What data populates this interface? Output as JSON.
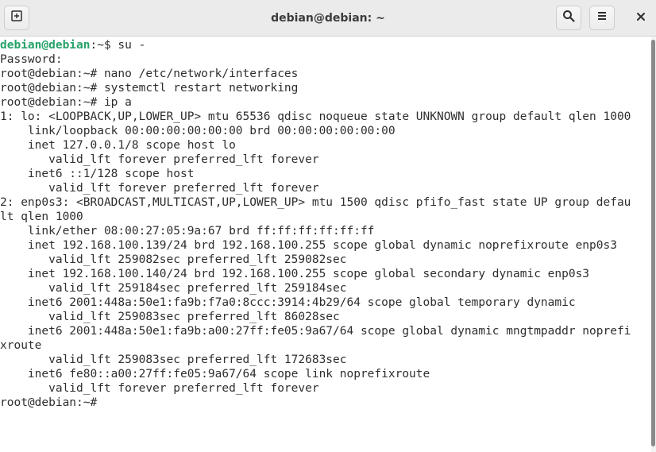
{
  "window": {
    "title": "debian@debian: ~"
  },
  "icons": {
    "new_tab": "new-tab-icon",
    "search": "search-icon",
    "menu": "hamburger-menu-icon",
    "close": "close-icon"
  },
  "colors": {
    "prompt_user": "#26a269",
    "text": "#2e2e2e",
    "titlebar": "#ebebeb"
  },
  "terminal": {
    "first_prompt": {
      "user": "debian@debian",
      "rest": ":~$ su -"
    },
    "lines": [
      "Password:",
      "root@debian:~# nano /etc/network/interfaces",
      "root@debian:~# systemctl restart networking",
      "root@debian:~# ip a",
      "1: lo: <LOOPBACK,UP,LOWER_UP> mtu 65536 qdisc noqueue state UNKNOWN group default qlen 1000",
      "    link/loopback 00:00:00:00:00:00 brd 00:00:00:00:00:00",
      "    inet 127.0.0.1/8 scope host lo",
      "       valid_lft forever preferred_lft forever",
      "    inet6 ::1/128 scope host",
      "       valid_lft forever preferred_lft forever",
      "2: enp0s3: <BROADCAST,MULTICAST,UP,LOWER_UP> mtu 1500 qdisc pfifo_fast state UP group defau",
      "lt qlen 1000",
      "    link/ether 08:00:27:05:9a:67 brd ff:ff:ff:ff:ff:ff",
      "    inet 192.168.100.139/24 brd 192.168.100.255 scope global dynamic noprefixroute enp0s3",
      "       valid_lft 259082sec preferred_lft 259082sec",
      "    inet 192.168.100.140/24 brd 192.168.100.255 scope global secondary dynamic enp0s3",
      "       valid_lft 259184sec preferred_lft 259184sec",
      "    inet6 2001:448a:50e1:fa9b:f7a0:8ccc:3914:4b29/64 scope global temporary dynamic",
      "       valid_lft 259083sec preferred_lft 86028sec",
      "    inet6 2001:448a:50e1:fa9b:a00:27ff:fe05:9a67/64 scope global dynamic mngtmpaddr noprefi",
      "xroute",
      "       valid_lft 259083sec preferred_lft 172683sec",
      "    inet6 fe80::a00:27ff:fe05:9a67/64 scope link noprefixroute",
      "       valid_lft forever preferred_lft forever",
      "root@debian:~# "
    ]
  }
}
